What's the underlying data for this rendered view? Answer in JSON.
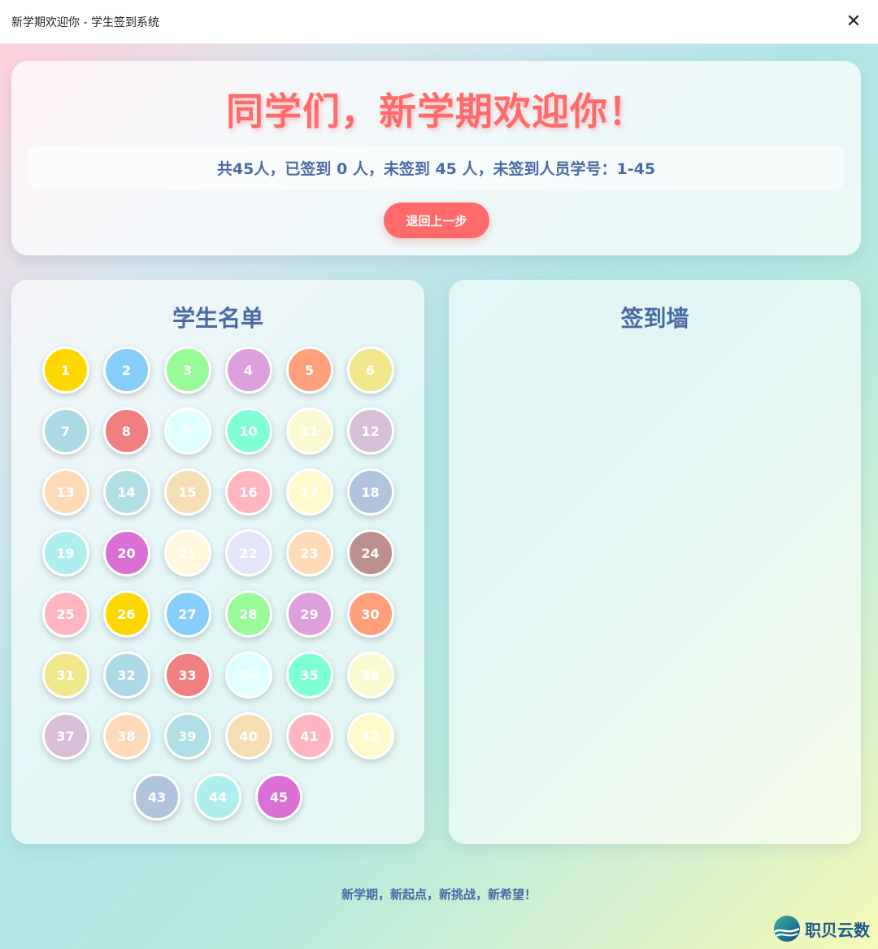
{
  "window": {
    "title": "新学期欢迎你 - 学生签到系统",
    "close_symbol": "✕"
  },
  "header": {
    "heading": "同学们，新学期欢迎你！",
    "status": "共45人，已签到 0 人，未签到 45 人，未签到人员学号：1-45",
    "back_button": "退回上一步"
  },
  "roster": {
    "title": "学生名单",
    "students": [
      {
        "no": "1",
        "color": "#FFD700"
      },
      {
        "no": "2",
        "color": "#87CEFA"
      },
      {
        "no": "3",
        "color": "#98FB98"
      },
      {
        "no": "4",
        "color": "#DDA0DD"
      },
      {
        "no": "5",
        "color": "#FFA07A"
      },
      {
        "no": "6",
        "color": "#F0E68C"
      },
      {
        "no": "7",
        "color": "#ADD8E6"
      },
      {
        "no": "8",
        "color": "#F08080"
      },
      {
        "no": "9",
        "color": "#E0FFFF"
      },
      {
        "no": "10",
        "color": "#7FFFD4"
      },
      {
        "no": "11",
        "color": "#FAFAD2"
      },
      {
        "no": "12",
        "color": "#D8BFD8"
      },
      {
        "no": "13",
        "color": "#FFDAB9"
      },
      {
        "no": "14",
        "color": "#B0E0E6"
      },
      {
        "no": "15",
        "color": "#F5DEB3"
      },
      {
        "no": "16",
        "color": "#FFB6C1"
      },
      {
        "no": "17",
        "color": "#FFFACD"
      },
      {
        "no": "18",
        "color": "#B0C4DE"
      },
      {
        "no": "19",
        "color": "#AFEEEE"
      },
      {
        "no": "20",
        "color": "#DA70D6"
      },
      {
        "no": "21",
        "color": "#FFF8DC"
      },
      {
        "no": "22",
        "color": "#E6E6FA"
      },
      {
        "no": "23",
        "color": "#FFDAB9"
      },
      {
        "no": "24",
        "color": "#BC8F8F"
      },
      {
        "no": "25",
        "color": "#FFB6C1"
      },
      {
        "no": "26",
        "color": "#FFD700"
      },
      {
        "no": "27",
        "color": "#87CEFA"
      },
      {
        "no": "28",
        "color": "#98FB98"
      },
      {
        "no": "29",
        "color": "#DDA0DD"
      },
      {
        "no": "30",
        "color": "#FFA07A"
      },
      {
        "no": "31",
        "color": "#F0E68C"
      },
      {
        "no": "32",
        "color": "#ADD8E6"
      },
      {
        "no": "33",
        "color": "#F08080"
      },
      {
        "no": "34",
        "color": "#E0FFFF"
      },
      {
        "no": "35",
        "color": "#7FFFD4"
      },
      {
        "no": "36",
        "color": "#FAFAD2"
      },
      {
        "no": "37",
        "color": "#D8BFD8"
      },
      {
        "no": "38",
        "color": "#FFDAB9"
      },
      {
        "no": "39",
        "color": "#B0E0E6"
      },
      {
        "no": "40",
        "color": "#F5DEB3"
      },
      {
        "no": "41",
        "color": "#FFB6C1"
      },
      {
        "no": "42",
        "color": "#FFFACD"
      },
      {
        "no": "43",
        "color": "#B0C4DE"
      },
      {
        "no": "44",
        "color": "#AFEEEE"
      },
      {
        "no": "45",
        "color": "#DA70D6"
      }
    ]
  },
  "wall": {
    "title": "签到墙"
  },
  "footer": {
    "slogan": "新学期，新起点，新挑战，新希望！",
    "brand": "职贝云数",
    "brand_icon": "globe-wave-logo"
  },
  "colors": {
    "accent": "#FF6B6B",
    "heading_blue": "#4A6AA5"
  }
}
